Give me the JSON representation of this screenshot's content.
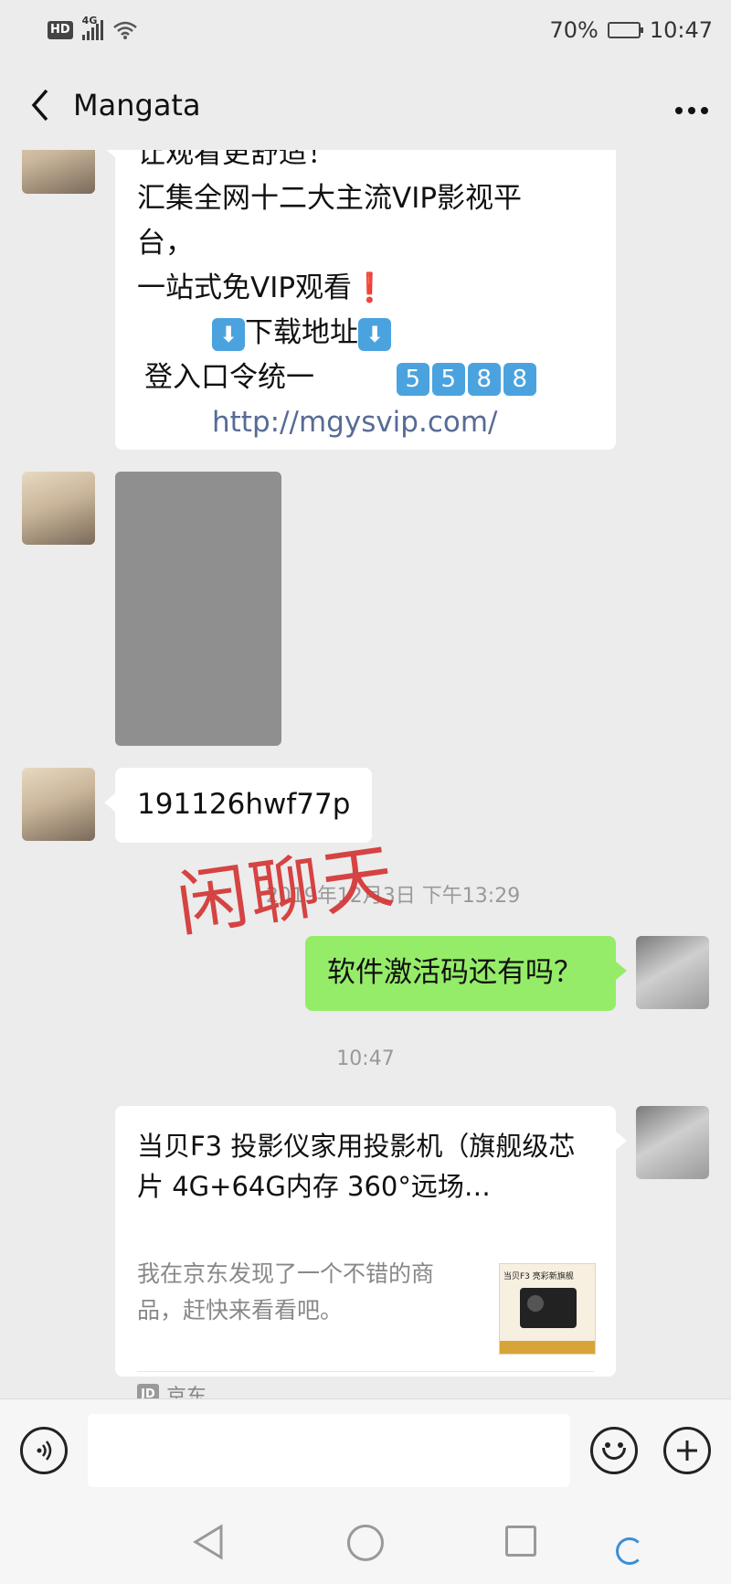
{
  "status_bar": {
    "hd": "HD",
    "network": "4G",
    "battery_percent": "70%",
    "battery_level": 0.7,
    "time": "10:47"
  },
  "header": {
    "title": "Mangata"
  },
  "messages": {
    "promo": {
      "lines": [
        "让观看更舒适！",
        "汇集全网十二大主流VIP影视平",
        "台，",
        "一站式免VIP观看",
        "下载地址",
        "登入口令统一",
        "http://mgysvip.com/"
      ],
      "exclaim": "❗",
      "arrow": "⬇",
      "code_digits": [
        "5",
        "5",
        "8",
        "8"
      ]
    },
    "code": "191126hwf77p",
    "stamp": "闲聊天",
    "timestamp_1": "2019年12月3日 下午13:29",
    "question": "软件激活码还有吗？",
    "timestamp_2": "10:47",
    "card": {
      "title": "当贝F3 投影仪家用投影机（旗舰级芯片 4G+64G内存 360°远场…",
      "desc": "我在京东发现了一个不错的商品，赶快来看看吧。",
      "thumb_title": "当贝F3 亮彩新旗舰",
      "source_icon": "JD",
      "source": "京东"
    }
  },
  "input_bar": {
    "placeholder": ""
  },
  "icons": {
    "back": "chevron-left-icon",
    "more": "more-icon",
    "voice": "voice-icon",
    "emoji": "emoji-icon",
    "plus": "plus-icon"
  },
  "colors": {
    "my_bubble": "#95ec69",
    "link": "#576b95",
    "stamp": "#d43a3a"
  }
}
